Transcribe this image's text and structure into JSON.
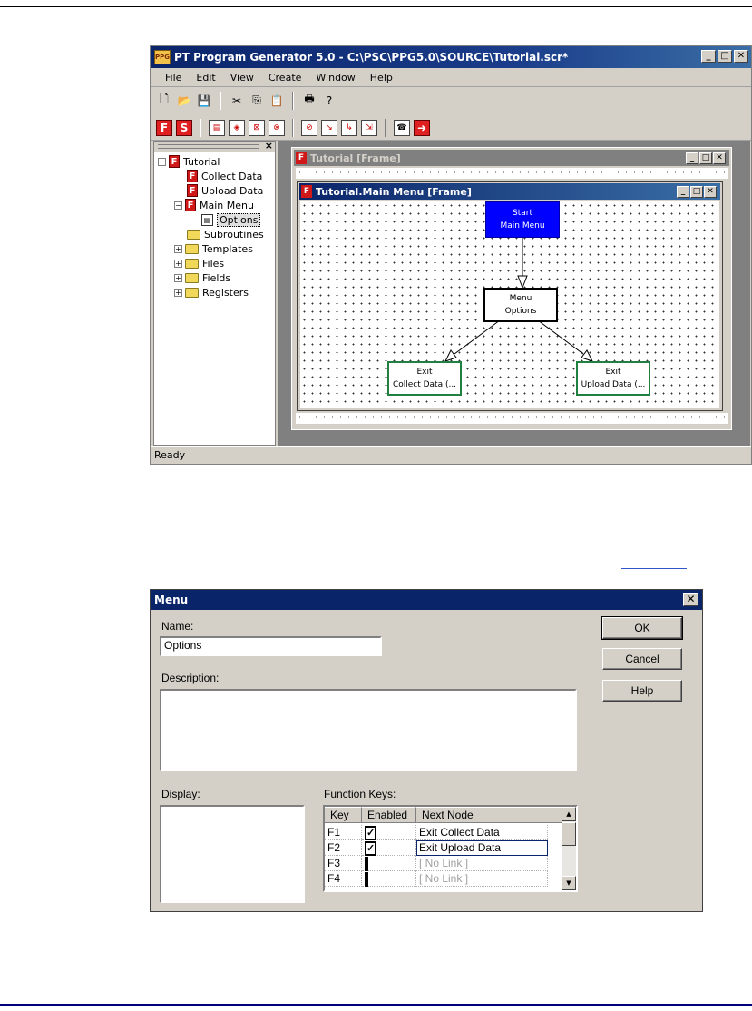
{
  "app": {
    "title": "PT Program Generator 5.0 - C:\\PSC\\PPG5.0\\SOURCE\\Tutorial.scr*",
    "icon_text": "PPG",
    "menu": [
      "File",
      "Edit",
      "View",
      "Create",
      "Window",
      "Help"
    ],
    "toolbar1_icons": [
      "new-file-icon",
      "open-folder-icon",
      "save-icon",
      "cut-icon",
      "copy-icon",
      "paste-icon",
      "print-icon",
      "help-question-icon"
    ],
    "toolbar2_icons": [
      "frame-f-icon",
      "subroutine-s-icon",
      "options-icon",
      "menu-node-icon",
      "node-type-icon",
      "node-type-2-icon",
      "link-icon",
      "link-2-icon",
      "link-3-icon",
      "link-4-icon",
      "phone-icon",
      "exit-arrow-icon"
    ],
    "tree": {
      "root": "Tutorial",
      "items": [
        "Collect Data",
        "Upload Data",
        "Main Menu",
        "Options",
        "Subroutines",
        "Templates",
        "Files",
        "Fields",
        "Registers"
      ]
    },
    "outer_frame_title": "Tutorial [Frame]",
    "inner_frame_title": "Tutorial.Main Menu [Frame]",
    "nodes": {
      "start": [
        "Start",
        "Main Menu"
      ],
      "menu": [
        "Menu",
        "Options"
      ],
      "exit1": [
        "Exit",
        "Collect Data (..."
      ],
      "exit2": [
        "Exit",
        "Upload Data (..."
      ]
    },
    "status": "Ready"
  },
  "dialog": {
    "title": "Menu",
    "name_label": "Name:",
    "name_value": "Options",
    "description_label": "Description:",
    "display_label": "Display:",
    "function_keys_label": "Function Keys:",
    "buttons": {
      "ok": "OK",
      "cancel": "Cancel",
      "help": "Help"
    },
    "columns": [
      "Key",
      "Enabled",
      "Next Node"
    ],
    "rows": [
      {
        "key": "F1",
        "enabled": true,
        "next": "Exit Collect Data"
      },
      {
        "key": "F2",
        "enabled": true,
        "next": "Exit Upload Data"
      },
      {
        "key": "F3",
        "enabled": false,
        "next": "[ No Link ]"
      },
      {
        "key": "F4",
        "enabled": false,
        "next": "[ No Link ]"
      }
    ]
  }
}
